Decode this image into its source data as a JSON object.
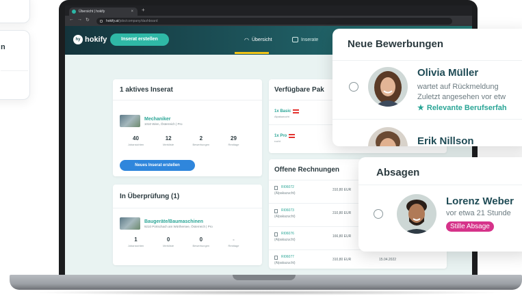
{
  "left_card": {
    "title": "n"
  },
  "browser": {
    "tab_title": "Übersicht | hokify",
    "new_tab": "+",
    "url_host": "hokify.at",
    "url_path": "/jobs/company/dashboard"
  },
  "app": {
    "logo": "hokify",
    "create_button": "Inserat erstellen",
    "nav": [
      {
        "label": "Übersicht",
        "active": true
      },
      {
        "label": "Inserate"
      }
    ]
  },
  "active_card": {
    "title": "1 aktives Inserat",
    "job": {
      "title": "Mechaniker",
      "subtitle": "1010 Wien, Österreich | Pro"
    },
    "stats": [
      {
        "value": "40",
        "label": "Jobansichten"
      },
      {
        "value": "12",
        "label": "Merkliste"
      },
      {
        "value": "2",
        "label": "Bewerbungen"
      },
      {
        "value": "29",
        "label": "Resttage"
      }
    ],
    "button": "Neues Inserat erstellen"
  },
  "review_card": {
    "title": "In Überprüfung (1)",
    "job": {
      "title": "Baugeräte/Baumaschinen",
      "subtitle": "9210 Pörtschach am Wörthersee, Österreich | Pro"
    },
    "stats": [
      {
        "value": "1",
        "label": "Jobansichten"
      },
      {
        "value": "0",
        "label": "Merkliste"
      },
      {
        "value": "0",
        "label": "Bewerbungen"
      },
      {
        "value": "-",
        "label": "Resttage"
      }
    ]
  },
  "packages_card": {
    "title": "Verfügbare Pak",
    "items": [
      {
        "name": "1x Basic",
        "sub": "Alpakazucht"
      },
      {
        "name": "1x Pro",
        "sub": "rucht"
      }
    ]
  },
  "invoices_card": {
    "title": "Offene Rechnungen",
    "items": [
      {
        "number": "RI06072",
        "sub": "(Alpakazucht)",
        "amount": "310,80 EUR",
        "date": ""
      },
      {
        "number": "RI06073",
        "sub": "(Alpakazucht)",
        "amount": "310,80 EUR",
        "date": ""
      },
      {
        "number": "RI06076",
        "sub": "(Alpakazucht)",
        "amount": "166,80 EUR",
        "date": ""
      },
      {
        "number": "RI06077",
        "sub": "(Alpakazucht)",
        "amount": "310,80 EUR",
        "date": "15.04.2022"
      }
    ]
  },
  "applications_panel": {
    "title": "Neue Bewerbungen",
    "applicants": [
      {
        "name": "Olivia Müller",
        "status": "wartet auf Rückmeldung",
        "seen": "Zuletzt angesehen vor etw",
        "tag": "Relevante Berufserfah",
        "tag_icon": "star-icon"
      },
      {
        "name": "Erik Nillson"
      }
    ]
  },
  "rejections_panel": {
    "title": "Absagen",
    "person": {
      "name": "Lorenz Weber",
      "time": "vor etwa 21 Stunde",
      "badge": "Stille Absage"
    }
  },
  "colors": {
    "accent": "#2fb8a6",
    "teal_text": "#2aa596",
    "blue_button": "#2f86dc",
    "badge": "#d6338a",
    "header_dark": "#14343c"
  }
}
